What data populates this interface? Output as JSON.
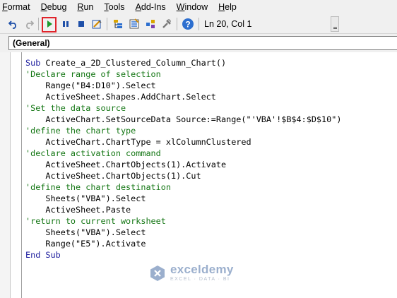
{
  "menu": {
    "items": [
      {
        "label": "Format",
        "accel_index": 0
      },
      {
        "label": "Debug",
        "accel_index": 0
      },
      {
        "label": "Run",
        "accel_index": 0
      },
      {
        "label": "Tools",
        "accel_index": 0
      },
      {
        "label": "Add-Ins",
        "accel_index": 0
      },
      {
        "label": "Window",
        "accel_index": 0
      },
      {
        "label": "Help",
        "accel_index": 0
      }
    ]
  },
  "toolbar": {
    "buttons": [
      {
        "name": "undo-icon"
      },
      {
        "name": "redo-icon"
      },
      {
        "name": "run-icon"
      },
      {
        "name": "break-icon"
      },
      {
        "name": "reset-icon"
      },
      {
        "name": "design-mode-icon"
      },
      {
        "name": "project-explorer-icon"
      },
      {
        "name": "properties-window-icon"
      },
      {
        "name": "object-browser-icon"
      },
      {
        "name": "toolbox-icon"
      },
      {
        "name": "help-icon"
      }
    ],
    "highlight_color": "#e0242b",
    "status": "Ln 20, Col 1"
  },
  "object_dropdown": {
    "value": "(General)"
  },
  "code": {
    "lines": [
      {
        "type": "code",
        "text": "Sub Create_a_2D_Clustered_Column_Chart()"
      },
      {
        "type": "comment",
        "text": "'Declare range of selection"
      },
      {
        "type": "code",
        "text": "    Range(\"B4:D10\").Select"
      },
      {
        "type": "code",
        "text": "    ActiveSheet.Shapes.AddChart.Select"
      },
      {
        "type": "comment",
        "text": "'Set the data source"
      },
      {
        "type": "code",
        "text": "    ActiveChart.SetSourceData Source:=Range(\"'VBA'!$B$4:$D$10\")"
      },
      {
        "type": "comment",
        "text": "'define the chart type"
      },
      {
        "type": "code",
        "text": "    ActiveChart.ChartType = xlColumnClustered"
      },
      {
        "type": "comment",
        "text": "'declare activation command"
      },
      {
        "type": "code",
        "text": "    ActiveSheet.ChartObjects(1).Activate"
      },
      {
        "type": "code",
        "text": "    ActiveSheet.ChartObjects(1).Cut"
      },
      {
        "type": "comment",
        "text": "'define the chart destination"
      },
      {
        "type": "code",
        "text": "    Sheets(\"VBA\").Select"
      },
      {
        "type": "code",
        "text": "    ActiveSheet.Paste"
      },
      {
        "type": "comment",
        "text": "'return to current worksheet"
      },
      {
        "type": "code",
        "text": "    Sheets(\"VBA\").Select"
      },
      {
        "type": "code",
        "text": "    Range(\"E5\").Activate"
      },
      {
        "type": "code",
        "text": "End Sub"
      }
    ],
    "colors": {
      "keyword": "#1d1d9e",
      "comment": "#137613",
      "text": "#000000"
    }
  },
  "watermark": {
    "name": "exceldemy",
    "tagline": "EXCEL · DATA · BI"
  }
}
